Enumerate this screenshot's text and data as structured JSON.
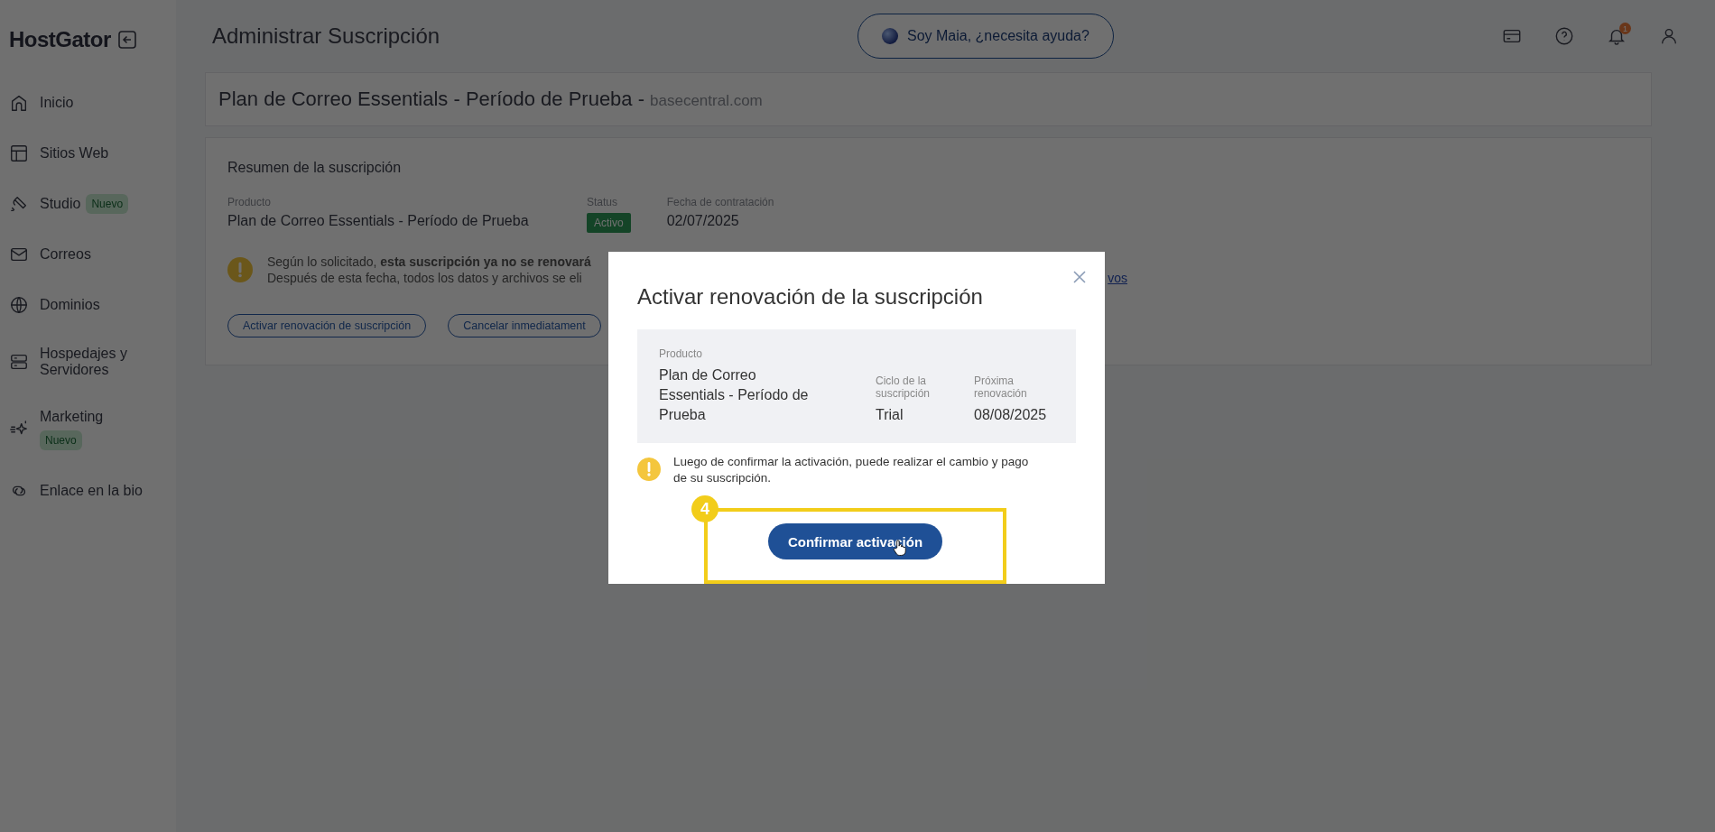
{
  "sidebar": {
    "logo": "HostGator",
    "items": [
      {
        "label": "Inicio"
      },
      {
        "label": "Sitios Web"
      },
      {
        "label": "Studio",
        "badge": "Nuevo"
      },
      {
        "label": "Correos"
      },
      {
        "label": "Dominios"
      },
      {
        "label": "Hospedajes y Servidores"
      },
      {
        "label": "Marketing",
        "badge": "Nuevo"
      },
      {
        "label": "Enlace en la bio"
      }
    ]
  },
  "header": {
    "title": "Administrar Suscripción",
    "assistant_button": "Soy Maia, ¿necesita ayuda?",
    "notification_count": "1"
  },
  "plan_header": {
    "title": "Plan de Correo Essentials - Período de Prueba - ",
    "domain": "basecentral.com"
  },
  "summary": {
    "heading": "Resumen de la suscripción",
    "fields": [
      {
        "kind": "text",
        "label": "Producto",
        "value": "Plan de Correo Essentials - Período de Prueba"
      },
      {
        "kind": "badge",
        "label": "Status",
        "value": "Activo"
      },
      {
        "kind": "text",
        "label": "Fecha de contratación",
        "value": "02/07/2025"
      }
    ],
    "alert": {
      "line_1": "Según lo solicitado, **esta suscripción ya no se renovará**",
      "line_2": "Después de esta fecha, todos los datos y archivos se eli",
      "link": "vos"
    },
    "buttons": [
      "Activar renovación de suscripción",
      "Cancelar inmediatament"
    ]
  },
  "modal": {
    "title": "Activar renovación de la suscripción",
    "details": [
      {
        "label": "Producto",
        "value": "Plan de Correo Essentials - Período de Prueba"
      },
      {
        "label": "Ciclo de la suscripción",
        "value": "Trial"
      },
      {
        "label": "Próxima renovación",
        "value": "08/08/2025"
      }
    ],
    "warning": "Luego de confirmar la activación, puede realizar el cambio y pago de su suscripción.",
    "confirm_button": "Confirmar activación",
    "step_badge": "4"
  }
}
